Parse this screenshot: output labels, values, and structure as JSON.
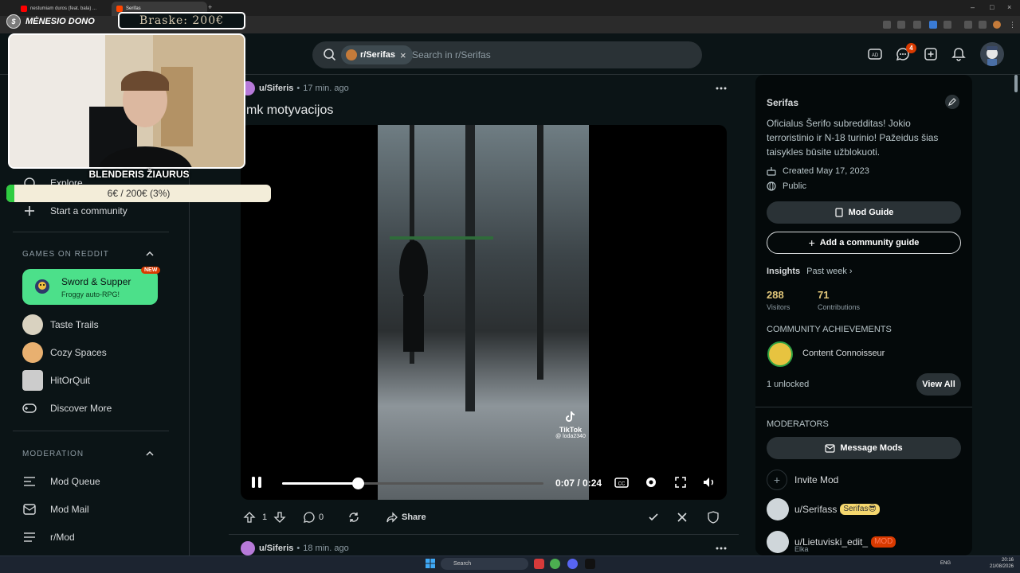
{
  "browser": {
    "tabs": [
      {
        "title": "nestumiam duros (feat. bala) ...",
        "active": false,
        "color": "#ff0000"
      },
      {
        "title": "Serifas",
        "active": true,
        "color": "#ff4500"
      }
    ]
  },
  "overlay": {
    "donate_label": "MĖNESIO DONO",
    "coin": "$",
    "goal_text": "Braske: 200€",
    "donor_name": "BLENDERIS ŽIAURUS",
    "progress_text": "6€ / 200€ (3%)",
    "progress_fraction": 0.03
  },
  "header": {
    "search_chip": "r/Serifas",
    "search_placeholder": "Search in r/Serifas",
    "notification_count": "4"
  },
  "left_sidebar": {
    "explore": "Explore",
    "start_community": "Start a community",
    "games_heading": "GAMES ON REDDIT",
    "featured_game": {
      "title": "Sword & Supper",
      "subtitle": "Froggy auto-RPG!",
      "badge": "NEW"
    },
    "games": [
      "Taste Trails",
      "Cozy Spaces",
      "HitOrQuit",
      "Discover More"
    ],
    "moderation_heading": "MODERATION",
    "moderation_items": [
      "Mod Queue",
      "Mod Mail",
      "r/Mod"
    ]
  },
  "post": {
    "author": "u/Siferis",
    "time": "17 min. ago",
    "title": "mk motyvacijos",
    "tiktok_label": "TikTok",
    "tiktok_handle": "@ loda2340",
    "video_time": "0:07 / 0:24",
    "video_progress": 0.29,
    "votes": "1",
    "comments": "0",
    "share_label": "Share"
  },
  "post2": {
    "author": "u/Siferis",
    "time": "18 min. ago"
  },
  "right_sidebar": {
    "name": "Serifas",
    "description": "Oficialus Šerifo subredditas! Jokio terroristinio ir N-18 turinio! Pažeidus šias taisykles būsite užblokuoti.",
    "created": "Created May 17, 2023",
    "visibility": "Public",
    "mod_guide": "Mod Guide",
    "add_guide": "Add a community guide",
    "insights_label": "Insights",
    "insights_period": "Past week",
    "visitors_value": "288",
    "visitors_label": "Visitors",
    "contributions_value": "71",
    "contributions_label": "Contributions",
    "achievements_heading": "COMMUNITY ACHIEVEMENTS",
    "achievement": "Content Connoisseur",
    "unlocked": "1 unlocked",
    "view_all": "View All",
    "moderators_heading": "MODERATORS",
    "message_mods": "Message Mods",
    "invite_mod": "Invite Mod",
    "mods": [
      {
        "name": "u/Serifass",
        "flair": "Serifas😎"
      },
      {
        "name": "u/Lietuviski_edit_",
        "flair": "MOD",
        "sub": "Elka"
      }
    ]
  },
  "taskbar": {
    "search": "Search",
    "lang": "ENG",
    "time": "20:16",
    "date": "21/08/2026"
  }
}
